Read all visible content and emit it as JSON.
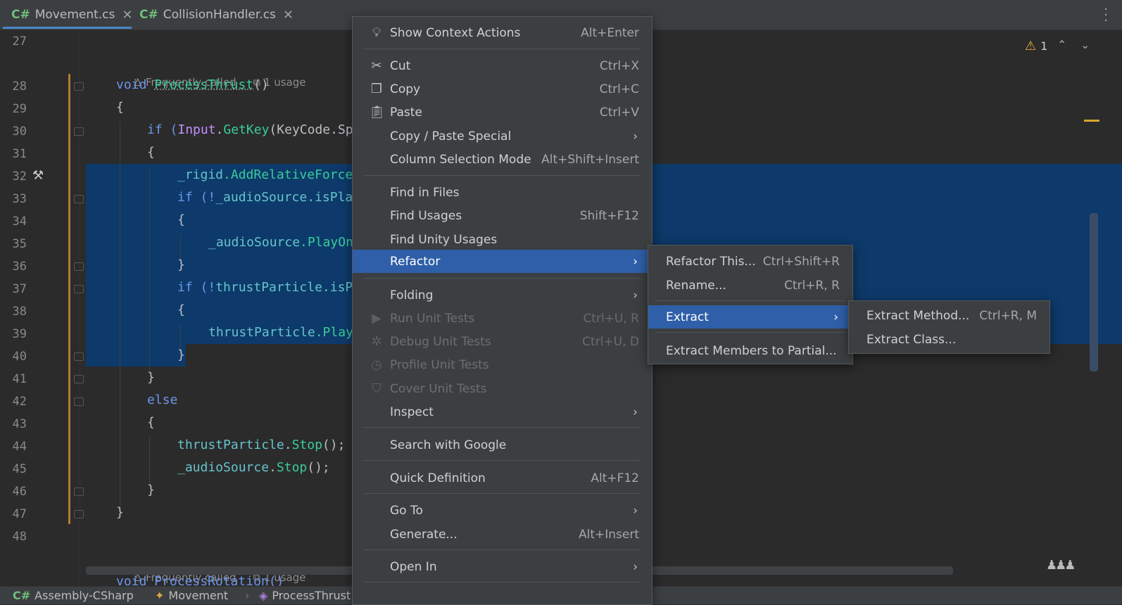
{
  "tabs": [
    {
      "icon": "C#",
      "label": "Movement.cs",
      "close": "✕"
    },
    {
      "icon": "C#",
      "label": "CollisionHandler.cs",
      "close": "✕"
    }
  ],
  "inlay_hints": {
    "frequently_called": "Frequently called",
    "usage": "1 usage"
  },
  "line_numbers": [
    "27",
    "28",
    "29",
    "30",
    "31",
    "32",
    "33",
    "34",
    "35",
    "36",
    "37",
    "38",
    "39",
    "40",
    "41",
    "42",
    "43",
    "44",
    "45",
    "46",
    "47",
    "48"
  ],
  "code": {
    "l28_void": "void ",
    "l28_fn": "ProcessThrust",
    "l28_rest": "()",
    "l29": "{",
    "l30_if": "if (",
    "l30_input": "Input",
    "l30_dot": ".",
    "l30_getkey": "GetKey",
    "l30_paren": "(",
    "l30_keycode": "KeyCode",
    "l30_sp": ".Sp",
    "l31": "{",
    "l32_field": "_rigid",
    "l32_rest": ".AddRelativeForce",
    "l33_if": "if (!",
    "l33_field": "_audioSource",
    "l33_rest": ".isPla",
    "l34": "{",
    "l35_field": "_audioSource",
    "l35_rest": ".PlayOn",
    "l36": "}",
    "l37_if": "if (!",
    "l37_field": "thrustParticle",
    "l37_rest": ".isP",
    "l38": "{",
    "l39_field": "thrustParticle",
    "l39_rest": ".Play",
    "l40": "}",
    "l41": "}",
    "l42": "else",
    "l43": "{",
    "l44_field": "thrustParticle",
    "l44_dot": ".",
    "l44_fn": "Stop",
    "l44_rest": "();",
    "l45_field": "_audioSource",
    "l45_dot": ".",
    "l45_fn": "Stop",
    "l45_rest": "();",
    "l46": "}",
    "l47": "}",
    "l49_partial": "void ProcessRotation()"
  },
  "warnings": {
    "count": "1"
  },
  "statusbar": {
    "project": "Assembly-CSharp",
    "class": "Movement",
    "method": "ProcessThrust"
  },
  "context_menu": {
    "items": [
      {
        "label": "Show Context Actions",
        "shortcut": "Alt+Enter",
        "icon": "bulb-icon"
      },
      {
        "label": "Cut",
        "shortcut": "Ctrl+X",
        "icon": "scissors-icon"
      },
      {
        "label": "Copy",
        "shortcut": "Ctrl+C",
        "icon": "copy-icon"
      },
      {
        "label": "Paste",
        "shortcut": "Ctrl+V",
        "icon": "paste-icon"
      },
      {
        "label": "Copy / Paste Special"
      },
      {
        "label": "Column Selection Mode",
        "shortcut": "Alt+Shift+Insert"
      },
      {
        "label": "Find in Files"
      },
      {
        "label": "Find Usages",
        "shortcut": "Shift+F12"
      },
      {
        "label": "Find Unity Usages"
      },
      {
        "label": "Refactor"
      },
      {
        "label": "Folding"
      },
      {
        "label": "Run Unit Tests",
        "shortcut": "Ctrl+U, R",
        "icon": "run-icon"
      },
      {
        "label": "Debug Unit Tests",
        "shortcut": "Ctrl+U, D",
        "icon": "bug-icon"
      },
      {
        "label": "Profile Unit Tests",
        "icon": "stopwatch-icon"
      },
      {
        "label": "Cover Unit Tests",
        "icon": "shield-icon"
      },
      {
        "label": "Inspect"
      },
      {
        "label": "Search with Google"
      },
      {
        "label": "Quick Definition",
        "shortcut": "Alt+F12"
      },
      {
        "label": "Go To"
      },
      {
        "label": "Generate...",
        "shortcut": "Alt+Insert"
      },
      {
        "label": "Open In"
      }
    ]
  },
  "refactor_menu": {
    "items": [
      {
        "label": "Refactor This...",
        "shortcut": "Ctrl+Shift+R"
      },
      {
        "label": "Rename...",
        "shortcut": "Ctrl+R, R"
      },
      {
        "label": "Extract"
      },
      {
        "label": "Extract Members to Partial..."
      }
    ]
  },
  "extract_menu": {
    "items": [
      {
        "label": "Extract Method...",
        "shortcut": "Ctrl+R, M"
      },
      {
        "label": "Extract Class..."
      }
    ]
  }
}
